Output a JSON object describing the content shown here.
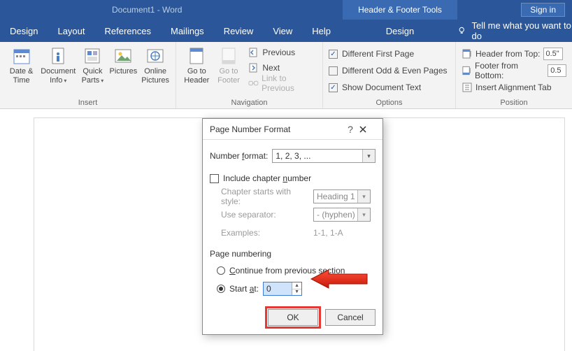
{
  "titlebar": {
    "doc_title": "Document1  -  Word",
    "tool_context": "Header & Footer Tools",
    "signin": "Sign in"
  },
  "tabs": {
    "design": "Design",
    "layout": "Layout",
    "references": "References",
    "mailings": "Mailings",
    "review": "Review",
    "view": "View",
    "help": "Help",
    "hf_design": "Design",
    "tellme": "Tell me what you want to do"
  },
  "ribbon": {
    "insert": {
      "label": "Insert",
      "date_time": "Date &\nTime",
      "doc_info": "Document\nInfo",
      "quick_parts": "Quick\nParts",
      "pictures": "Pictures",
      "online_pictures": "Online\nPictures"
    },
    "navigation": {
      "label": "Navigation",
      "goto_header": "Go to\nHeader",
      "goto_footer": "Go to\nFooter",
      "previous": "Previous",
      "next": "Next",
      "link_prev": "Link to Previous"
    },
    "options": {
      "label": "Options",
      "diff_first": "Different First Page",
      "diff_odd_even": "Different Odd & Even Pages",
      "show_doc_text": "Show Document Text",
      "diff_first_checked": true,
      "diff_odd_even_checked": false,
      "show_doc_text_checked": true
    },
    "position": {
      "label": "Position",
      "header_top": "Header from Top:",
      "footer_bottom": "Footer from Bottom:",
      "insert_align_tab": "Insert Alignment Tab",
      "header_val": "0.5\"",
      "footer_val": "0.5"
    }
  },
  "dialog": {
    "title": "Page Number Format",
    "number_format_label": "Number format:",
    "number_format_value": "1, 2, 3, ...",
    "include_chapter": "Include chapter number",
    "chapter_style_label": "Chapter starts with style:",
    "chapter_style_value": "Heading 1",
    "separator_label": "Use separator:",
    "separator_value": "-   (hyphen)",
    "examples_label": "Examples:",
    "examples_value": "1-1, 1-A",
    "page_numbering": "Page numbering",
    "continue": "Continue from previous section",
    "start_at": "Start at:",
    "start_at_value": "0",
    "ok": "OK",
    "cancel": "Cancel"
  }
}
